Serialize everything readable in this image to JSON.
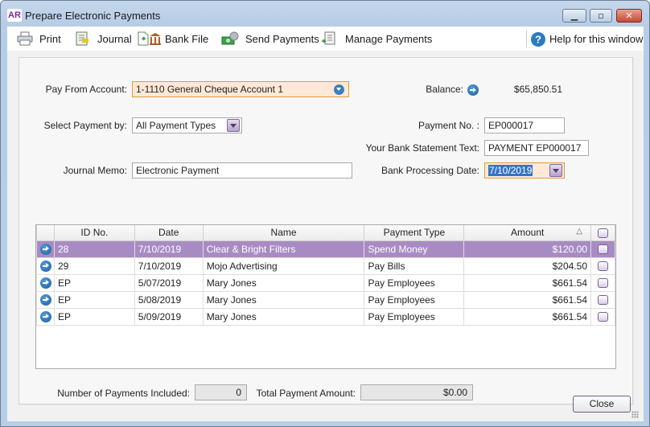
{
  "window": {
    "app_badge": "AR",
    "title": "Prepare Electronic Payments",
    "controls": {
      "minimize": "▁",
      "maximize": "▫",
      "close": "✕"
    }
  },
  "toolbar": {
    "items": [
      {
        "label": "Print",
        "icon": "printer-icon"
      },
      {
        "label": "Journal",
        "icon": "journal-icon"
      },
      {
        "label": "Bank File",
        "icon": "bank-file-icon"
      },
      {
        "label": "Send Payments",
        "icon": "send-payments-icon"
      },
      {
        "label": "Manage Payments",
        "icon": "manage-payments-icon"
      }
    ],
    "help": {
      "label": "Help for this window",
      "icon": "help-icon"
    }
  },
  "form": {
    "pay_from_account": {
      "label": "Pay From Account:",
      "value": "1-1110 General Cheque Account 1"
    },
    "balance": {
      "label": "Balance:",
      "value": "$65,850.51"
    },
    "select_payment_by": {
      "label": "Select Payment by:",
      "value": "All Payment Types"
    },
    "payment_no": {
      "label": "Payment No. :",
      "value": "EP000017"
    },
    "bank_statement_text": {
      "label": "Your Bank Statement Text:",
      "value": "PAYMENT EP000017"
    },
    "journal_memo": {
      "label": "Journal Memo:",
      "value": "Electronic Payment"
    },
    "bank_processing_date": {
      "label": "Bank Processing Date:",
      "value": "7/10/2019"
    }
  },
  "grid": {
    "columns": [
      "ID No.",
      "Date",
      "Name",
      "Payment Type",
      "Amount"
    ],
    "sort_indicator": "△",
    "rows": [
      {
        "id": "28",
        "date": "7/10/2019",
        "name": "Clear & Bright Filters",
        "type": "Spend Money",
        "amount": "$120.00",
        "selected": true
      },
      {
        "id": "29",
        "date": "7/10/2019",
        "name": "Mojo Advertising",
        "type": "Pay Bills",
        "amount": "$204.50",
        "selected": false
      },
      {
        "id": "EP",
        "date": "5/07/2019",
        "name": "Mary Jones",
        "type": "Pay Employees",
        "amount": "$661.54",
        "selected": false
      },
      {
        "id": "EP",
        "date": "5/08/2019",
        "name": "Mary Jones",
        "type": "Pay Employees",
        "amount": "$661.54",
        "selected": false
      },
      {
        "id": "EP",
        "date": "5/09/2019",
        "name": "Mary Jones",
        "type": "Pay Employees",
        "amount": "$661.54",
        "selected": false
      }
    ]
  },
  "summary": {
    "num_payments": {
      "label": "Number of Payments Included:",
      "value": "0"
    },
    "total_amount": {
      "label": "Total Payment Amount:",
      "value": "$0.00"
    }
  },
  "buttons": {
    "close": "Close"
  },
  "colors": {
    "accent": "#a98bc4",
    "highlight_field": "#fde9d5",
    "arrow_blue": "#2f73b5"
  }
}
